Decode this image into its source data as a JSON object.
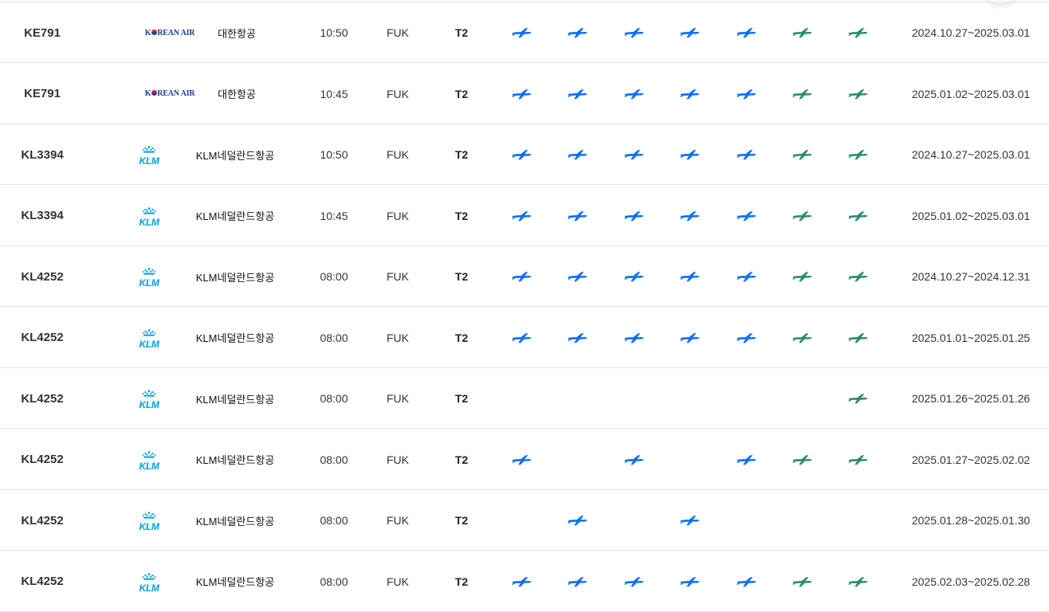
{
  "colors": {
    "plane_weekday": "#0d6efd",
    "plane_weekend": "#2e8b72",
    "korean_air_blue": "#1b3f93",
    "korean_air_red": "#d6262b",
    "klm_blue": "#00a1de",
    "row_border": "#e3e3e3"
  },
  "icons": {
    "weekday": "airplane-blue-icon",
    "weekend": "airplane-green-icon"
  },
  "rows": [
    {
      "flight": "KE791",
      "airline": "대한항공",
      "logo": "korean-air",
      "logo_text": "KOREAN AIR",
      "time": "10:50",
      "dest": "FUK",
      "terminal": "T2",
      "days": [
        true,
        true,
        true,
        true,
        true,
        true,
        true
      ],
      "period": "2024.10.27~2025.03.01"
    },
    {
      "flight": "KE791",
      "airline": "대한항공",
      "logo": "korean-air",
      "logo_text": "KOREAN AIR",
      "time": "10:45",
      "dest": "FUK",
      "terminal": "T2",
      "days": [
        true,
        true,
        true,
        true,
        true,
        true,
        true
      ],
      "period": "2025.01.02~2025.03.01"
    },
    {
      "flight": "KL3394",
      "airline": "KLM네덜란드항공",
      "logo": "klm",
      "logo_text": "KLM",
      "time": "10:50",
      "dest": "FUK",
      "terminal": "T2",
      "days": [
        true,
        true,
        true,
        true,
        true,
        true,
        true
      ],
      "period": "2024.10.27~2025.03.01"
    },
    {
      "flight": "KL3394",
      "airline": "KLM네덜란드항공",
      "logo": "klm",
      "logo_text": "KLM",
      "time": "10:45",
      "dest": "FUK",
      "terminal": "T2",
      "days": [
        true,
        true,
        true,
        true,
        true,
        true,
        true
      ],
      "period": "2025.01.02~2025.03.01"
    },
    {
      "flight": "KL4252",
      "airline": "KLM네덜란드항공",
      "logo": "klm",
      "logo_text": "KLM",
      "time": "08:00",
      "dest": "FUK",
      "terminal": "T2",
      "days": [
        true,
        true,
        true,
        true,
        true,
        true,
        true
      ],
      "period": "2024.10.27~2024.12.31"
    },
    {
      "flight": "KL4252",
      "airline": "KLM네덜란드항공",
      "logo": "klm",
      "logo_text": "KLM",
      "time": "08:00",
      "dest": "FUK",
      "terminal": "T2",
      "days": [
        true,
        true,
        true,
        true,
        true,
        true,
        true
      ],
      "period": "2025.01.01~2025.01.25"
    },
    {
      "flight": "KL4252",
      "airline": "KLM네덜란드항공",
      "logo": "klm",
      "logo_text": "KLM",
      "time": "08:00",
      "dest": "FUK",
      "terminal": "T2",
      "days": [
        false,
        false,
        false,
        false,
        false,
        false,
        true
      ],
      "period": "2025.01.26~2025.01.26"
    },
    {
      "flight": "KL4252",
      "airline": "KLM네덜란드항공",
      "logo": "klm",
      "logo_text": "KLM",
      "time": "08:00",
      "dest": "FUK",
      "terminal": "T2",
      "days": [
        true,
        false,
        true,
        false,
        true,
        true,
        true
      ],
      "period": "2025.01.27~2025.02.02"
    },
    {
      "flight": "KL4252",
      "airline": "KLM네덜란드항공",
      "logo": "klm",
      "logo_text": "KLM",
      "time": "08:00",
      "dest": "FUK",
      "terminal": "T2",
      "days": [
        false,
        true,
        false,
        true,
        false,
        false,
        false
      ],
      "period": "2025.01.28~2025.01.30"
    },
    {
      "flight": "KL4252",
      "airline": "KLM네덜란드항공",
      "logo": "klm",
      "logo_text": "KLM",
      "time": "08:00",
      "dest": "FUK",
      "terminal": "T2",
      "days": [
        true,
        true,
        true,
        true,
        true,
        true,
        true
      ],
      "period": "2025.02.03~2025.02.28"
    }
  ]
}
